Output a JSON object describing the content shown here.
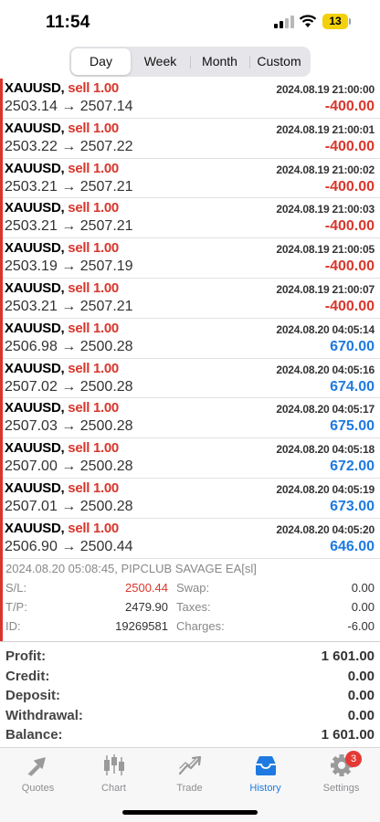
{
  "status": {
    "time": "11:54",
    "battery": "13"
  },
  "tabs": [
    {
      "label": "Day",
      "active": true
    },
    {
      "label": "Week",
      "active": false
    },
    {
      "label": "Month",
      "active": false
    },
    {
      "label": "Custom",
      "active": false
    }
  ],
  "trades": [
    {
      "symbol": "XAUUSD,",
      "side": "sell 1.00",
      "time": "2024.08.19 21:00:00",
      "prices": "2503.14 → 2507.14",
      "profit": "-400.00",
      "positive": false
    },
    {
      "symbol": "XAUUSD,",
      "side": "sell 1.00",
      "time": "2024.08.19 21:00:01",
      "prices": "2503.22 → 2507.22",
      "profit": "-400.00",
      "positive": false
    },
    {
      "symbol": "XAUUSD,",
      "side": "sell 1.00",
      "time": "2024.08.19 21:00:02",
      "prices": "2503.21 → 2507.21",
      "profit": "-400.00",
      "positive": false
    },
    {
      "symbol": "XAUUSD,",
      "side": "sell 1.00",
      "time": "2024.08.19 21:00:03",
      "prices": "2503.21 → 2507.21",
      "profit": "-400.00",
      "positive": false
    },
    {
      "symbol": "XAUUSD,",
      "side": "sell 1.00",
      "time": "2024.08.19 21:00:05",
      "prices": "2503.19 → 2507.19",
      "profit": "-400.00",
      "positive": false
    },
    {
      "symbol": "XAUUSD,",
      "side": "sell 1.00",
      "time": "2024.08.19 21:00:07",
      "prices": "2503.21 → 2507.21",
      "profit": "-400.00",
      "positive": false
    },
    {
      "symbol": "XAUUSD,",
      "side": "sell 1.00",
      "time": "2024.08.20 04:05:14",
      "prices": "2506.98 → 2500.28",
      "profit": "670.00",
      "positive": true
    },
    {
      "symbol": "XAUUSD,",
      "side": "sell 1.00",
      "time": "2024.08.20 04:05:16",
      "prices": "2507.02 → 2500.28",
      "profit": "674.00",
      "positive": true
    },
    {
      "symbol": "XAUUSD,",
      "side": "sell 1.00",
      "time": "2024.08.20 04:05:17",
      "prices": "2507.03 → 2500.28",
      "profit": "675.00",
      "positive": true
    },
    {
      "symbol": "XAUUSD,",
      "side": "sell 1.00",
      "time": "2024.08.20 04:05:18",
      "prices": "2507.00 → 2500.28",
      "profit": "672.00",
      "positive": true
    },
    {
      "symbol": "XAUUSD,",
      "side": "sell 1.00",
      "time": "2024.08.20 04:05:19",
      "prices": "2507.01 → 2500.28",
      "profit": "673.00",
      "positive": true
    },
    {
      "symbol": "XAUUSD,",
      "side": "sell 1.00",
      "time": "2024.08.20 04:05:20",
      "prices": "2506.90 → 2500.44",
      "profit": "646.00",
      "positive": true
    }
  ],
  "details": {
    "comment": "2024.08.20 05:08:45, PIPCLUB SAVAGE EA[sl]",
    "rows": [
      {
        "label1": "S/L:",
        "value1": "2500.44",
        "label2": "Swap:",
        "value2": "0.00"
      },
      {
        "label1": "T/P:",
        "value1": "2479.90",
        "label2": "Taxes:",
        "value2": "0.00"
      },
      {
        "label1": "ID:",
        "value1": "19269581",
        "label2": "Charges:",
        "value2": "-6.00"
      }
    ]
  },
  "summary": [
    {
      "label": "Profit:",
      "value": "1 601.00"
    },
    {
      "label": "Credit:",
      "value": "0.00"
    },
    {
      "label": "Deposit:",
      "value": "0.00"
    },
    {
      "label": "Withdrawal:",
      "value": "0.00"
    },
    {
      "label": "Balance:",
      "value": "1 601.00"
    }
  ],
  "tabbar": {
    "items": [
      {
        "label": "Quotes",
        "icon": "quotes-icon"
      },
      {
        "label": "Chart",
        "icon": "chart-icon"
      },
      {
        "label": "Trade",
        "icon": "trade-icon"
      },
      {
        "label": "History",
        "icon": "history-icon",
        "active": true
      },
      {
        "label": "Settings",
        "icon": "settings-icon",
        "badge": "3"
      }
    ]
  },
  "colors": {
    "loss": "#d9362b",
    "gain": "#1e7ae0",
    "accent": "#1e7ae0"
  }
}
